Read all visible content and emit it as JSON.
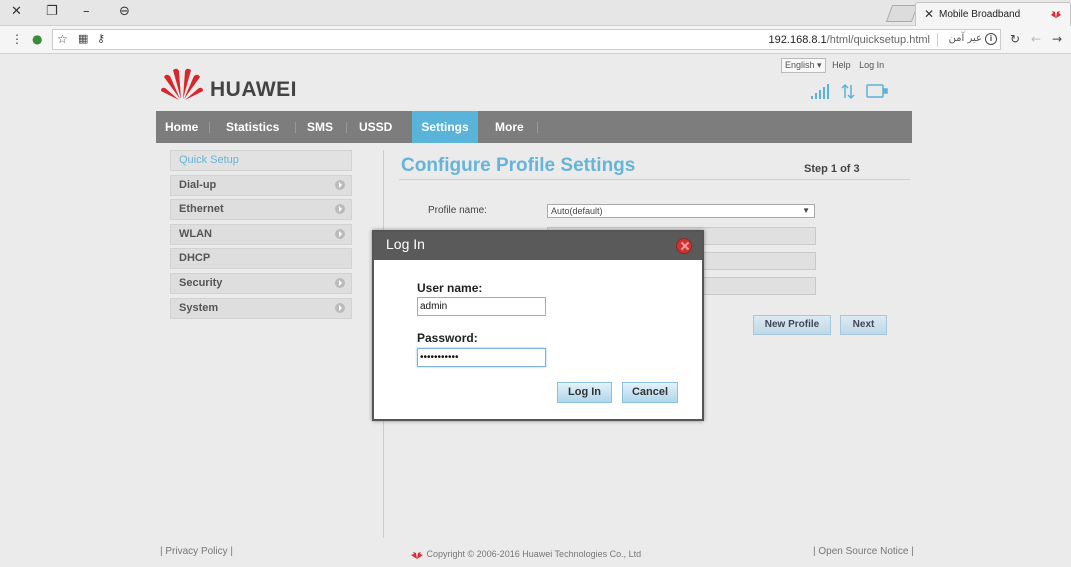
{
  "browser": {
    "tab_title": "Mobile Broadband",
    "url_host": "192.168.8.1",
    "url_path": "/html/quicksetup.html",
    "security_text": "عیر آمن"
  },
  "header": {
    "brand": "HUAWEI",
    "language": "English",
    "help": "Help",
    "login": "Log In"
  },
  "nav": {
    "items": [
      "Home",
      "Statistics",
      "SMS",
      "USSD",
      "Settings",
      "More"
    ],
    "active": "Settings"
  },
  "sidebar": {
    "items": [
      {
        "label": "Quick Setup",
        "arrow": false
      },
      {
        "label": "Dial-up",
        "arrow": true
      },
      {
        "label": "Ethernet",
        "arrow": true
      },
      {
        "label": "WLAN",
        "arrow": true
      },
      {
        "label": "DHCP",
        "arrow": false
      },
      {
        "label": "Security",
        "arrow": true
      },
      {
        "label": "System",
        "arrow": true
      }
    ]
  },
  "content": {
    "title": "Configure Profile Settings",
    "step": "Step 1 of 3",
    "profile_label": "Profile name:",
    "profile_value": "Auto(default)",
    "new_profile_button": "New Profile",
    "next_button": "Next"
  },
  "modal": {
    "title": "Log In",
    "username_label": "User name:",
    "username_value": "admin",
    "password_label": "Password:",
    "password_value": "•••••••••••",
    "login_button": "Log In",
    "cancel_button": "Cancel"
  },
  "footer": {
    "privacy": "Privacy Policy",
    "copyright": "Copyright © 2006-2016 Huawei Technologies Co., Ltd",
    "open_source": "Open Source Notice"
  },
  "colors": {
    "accent": "#5ab3d8",
    "nav_bg": "#7d7d7d",
    "brand_red": "#d8262b"
  }
}
